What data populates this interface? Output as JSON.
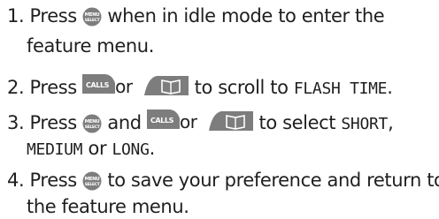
{
  "steps": [
    {
      "number": "1.",
      "parts": [
        "Press",
        "when in idle mode to enter the",
        "feature menu."
      ]
    },
    {
      "number": "2.",
      "parts": [
        "Press",
        "or",
        "to scroll to",
        "FLASH TIME",
        "."
      ]
    },
    {
      "number": "3.",
      "parts": [
        "Press",
        "and",
        "or",
        "to select",
        "SHORT",
        ",",
        "MEDIUM",
        "or",
        "LONG",
        "."
      ]
    },
    {
      "number": "4.",
      "parts": [
        "Press",
        "to save your preference and return to",
        "the feature menu."
      ]
    }
  ],
  "icons": {
    "menu_select": "menu-select-button-icon",
    "calls": "calls-button-icon",
    "phonebook": "phonebook-button-icon"
  },
  "icon_labels": {
    "menu_top": "MENU",
    "menu_bottom": "SELECT",
    "calls": "CALLS"
  },
  "colors": {
    "icon_bg": "#7d7d7d",
    "text": "#1f1f1f"
  }
}
